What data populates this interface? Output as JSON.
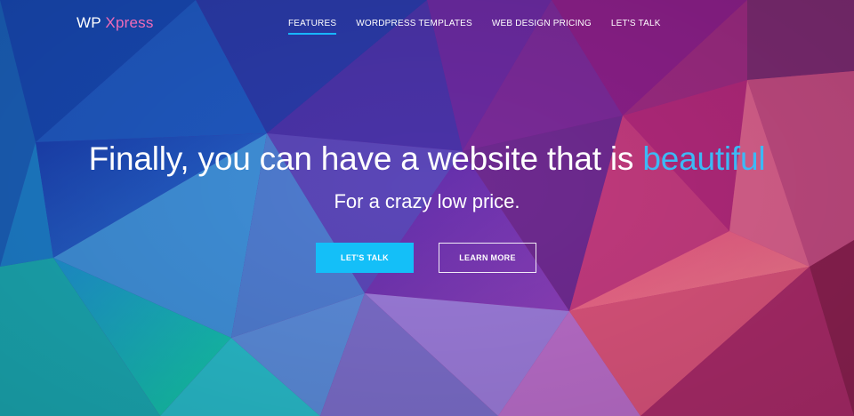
{
  "brand": {
    "prefix": "WP",
    "suffix": "Xpress"
  },
  "nav": {
    "items": [
      {
        "label": "FEATURES",
        "active": true
      },
      {
        "label": "WORDPRESS TEMPLATES",
        "active": false
      },
      {
        "label": "WEB DESIGN PRICING",
        "active": false
      },
      {
        "label": "LET'S TALK",
        "active": false
      }
    ]
  },
  "hero": {
    "headline_main": "Finally, you can have a website that is",
    "headline_accent": "beautiful",
    "subhead": "For a crazy low price.",
    "primary_button": "LET'S TALK",
    "secondary_button": "LEARN MORE"
  },
  "colors": {
    "accent": "#3cb9f5",
    "button_primary": "#14bff8",
    "brand_suffix": "#f06bb8"
  }
}
